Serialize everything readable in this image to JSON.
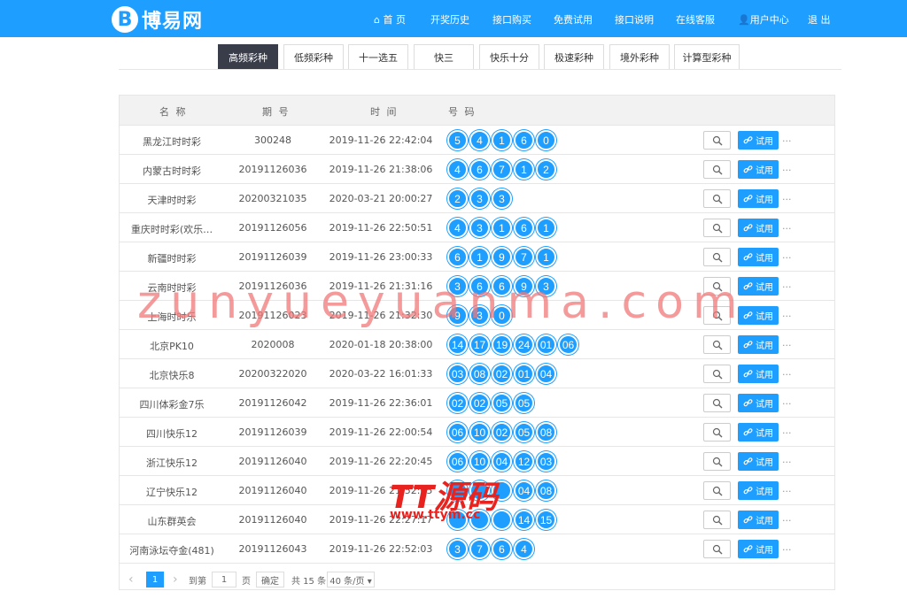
{
  "header": {
    "logo_letter": "B",
    "logo_text": "博易网",
    "nav": [
      {
        "label": "首 页",
        "icon": "home-icon"
      },
      {
        "label": "开奖历史"
      },
      {
        "label": "接口购买"
      },
      {
        "label": "免费试用"
      },
      {
        "label": "接口说明"
      },
      {
        "label": "在线客服"
      },
      {
        "label": "用户中心",
        "icon": "user-icon"
      },
      {
        "label": "退 出"
      }
    ]
  },
  "tabs": [
    "高频彩种",
    "低频彩种",
    "十一选五",
    "快三",
    "快乐十分",
    "极速彩种",
    "境外彩种",
    "计算型彩种"
  ],
  "active_tab": "高频彩种",
  "table": {
    "columns": [
      "名 称",
      "期 号",
      "时 间",
      "号 码"
    ],
    "try_label": "试用",
    "more_label": "...",
    "rows": [
      {
        "name": "黑龙江时时彩",
        "period": "300248",
        "time": "2019-11-26 22:42:04",
        "numbers": [
          "5",
          "4",
          "1",
          "6",
          "0"
        ]
      },
      {
        "name": "内蒙古时时彩",
        "period": "20191126036",
        "time": "2019-11-26 21:38:06",
        "numbers": [
          "4",
          "6",
          "7",
          "1",
          "2"
        ]
      },
      {
        "name": "天津时时彩",
        "period": "20200321035",
        "time": "2020-03-21 20:00:27",
        "numbers": [
          "2",
          "3",
          "3"
        ]
      },
      {
        "name": "重庆时时彩(欢乐…",
        "period": "20191126056",
        "time": "2019-11-26 22:50:51",
        "numbers": [
          "4",
          "3",
          "1",
          "6",
          "1"
        ]
      },
      {
        "name": "新疆时时彩",
        "period": "20191126039",
        "time": "2019-11-26 23:00:33",
        "numbers": [
          "6",
          "1",
          "9",
          "7",
          "1"
        ]
      },
      {
        "name": "云南时时彩",
        "period": "20191126036",
        "time": "2019-11-26 21:31:16",
        "numbers": [
          "3",
          "6",
          "6",
          "9",
          "3"
        ]
      },
      {
        "name": "上海时时乐",
        "period": "20191126023",
        "time": "2019-11-26 21:32:30",
        "numbers": [
          "9",
          "3",
          "0"
        ]
      },
      {
        "name": "北京PK10",
        "period": "2020008",
        "time": "2020-01-18 20:38:00",
        "numbers": [
          "14",
          "17",
          "19",
          "24",
          "01",
          "06"
        ]
      },
      {
        "name": "北京快乐8",
        "period": "20200322020",
        "time": "2020-03-22 16:01:33",
        "numbers": [
          "03",
          "08",
          "02",
          "01",
          "04"
        ]
      },
      {
        "name": "四川体彩金7乐",
        "period": "20191126042",
        "time": "2019-11-26 22:36:01",
        "numbers": [
          "02",
          "02",
          "05",
          "05"
        ]
      },
      {
        "name": "四川快乐12",
        "period": "20191126039",
        "time": "2019-11-26 22:00:54",
        "numbers": [
          "06",
          "10",
          "02",
          "05",
          "08"
        ]
      },
      {
        "name": "浙江快乐12",
        "period": "20191126040",
        "time": "2019-11-26 22:20:45",
        "numbers": [
          "06",
          "10",
          "04",
          "12",
          "03"
        ]
      },
      {
        "name": "辽宁快乐12",
        "period": "20191126040",
        "time": "2019-11-26 21:52:05",
        "numbers": [
          "",
          "",
          "",
          "04",
          "08"
        ]
      },
      {
        "name": "山东群英会",
        "period": "20191126040",
        "time": "2019-11-26 22:27:17",
        "numbers": [
          "",
          "",
          "",
          "14",
          "15"
        ]
      },
      {
        "name": "河南泳坛夺金(481)",
        "period": "20191126043",
        "time": "2019-11-26 22:52:03",
        "numbers": [
          "3",
          "7",
          "6",
          "4"
        ]
      }
    ]
  },
  "pager": {
    "prev": "‹",
    "current": "1",
    "next": "›",
    "goto_label": "到第",
    "goto_value": "1",
    "page_suffix": "页",
    "confirm": "确定",
    "total": "共 15 条",
    "page_size": "40 条/页 ▾"
  },
  "watermark": {
    "main": "zunyueyuanma.com",
    "badge": "TT源码",
    "badge_url": "www.ttym.cc"
  }
}
